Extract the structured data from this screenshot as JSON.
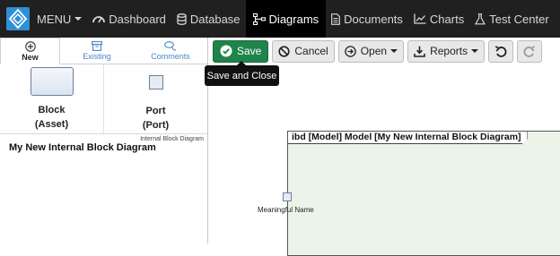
{
  "nav": {
    "menu_label": "MENU",
    "items": [
      {
        "label": "Dashboard",
        "icon": "dashboard-icon"
      },
      {
        "label": "Database",
        "icon": "database-icon"
      },
      {
        "label": "Diagrams",
        "icon": "diagrams-icon",
        "active": true
      },
      {
        "label": "Documents",
        "icon": "documents-icon"
      },
      {
        "label": "Charts",
        "icon": "charts-icon"
      },
      {
        "label": "Test Center",
        "icon": "flask-icon"
      }
    ]
  },
  "sidebar": {
    "tabs": [
      {
        "label": "New",
        "icon": "plus-circle-icon",
        "active": true
      },
      {
        "label": "Existing",
        "icon": "folder-icon"
      },
      {
        "label": "Comments",
        "icon": "comments-icon"
      }
    ],
    "palette": [
      {
        "line1": "Block",
        "line2": "(Asset)"
      },
      {
        "line1": "Port",
        "line2": "(Port)"
      }
    ],
    "diagram": {
      "type": "Internal Block Diagram",
      "name": "My New Internal Block Diagram"
    }
  },
  "toolbar": {
    "save_label": "Save",
    "cancel_label": "Cancel",
    "open_label": "Open",
    "reports_label": "Reports",
    "tooltip": "Save and Close"
  },
  "canvas": {
    "frame_title": "ibd [Model] Model [My New Internal Block Diagram]",
    "port_label": "Meaningful Name"
  },
  "colors": {
    "nav_bg": "#202020",
    "save_green": "#1e8449",
    "frame_fill": "#ecf3e8",
    "brand_blue": "#2f8fd8"
  }
}
